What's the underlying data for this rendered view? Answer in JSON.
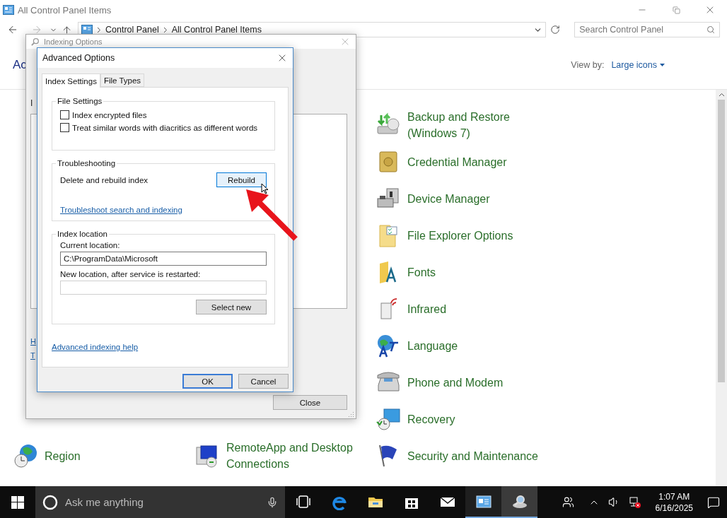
{
  "window": {
    "title": "All Control Panel Items"
  },
  "address_bar": {
    "breadcrumbs": [
      "Control Panel",
      "All Control Panel Items"
    ]
  },
  "search": {
    "placeholder": "Search Control Panel"
  },
  "header": {
    "title": "Ac",
    "view_by_label": "View by:",
    "view_by_value": "Large icons"
  },
  "columns": [
    {
      "items": [
        {
          "label": "Region",
          "kind": "region"
        }
      ]
    },
    {
      "items": [
        {
          "label": "RemoteApp and Desktop Connections",
          "kind": "remoteapp"
        }
      ]
    },
    {
      "items": [
        {
          "label": "Backup and Restore (Windows 7)",
          "kind": "backup"
        },
        {
          "label": "Credential Manager",
          "kind": "credential"
        },
        {
          "label": "Device Manager",
          "kind": "device"
        },
        {
          "label": "File Explorer Options",
          "kind": "folder-options"
        },
        {
          "label": "Fonts",
          "kind": "fonts"
        },
        {
          "label": "Infrared",
          "kind": "infrared"
        },
        {
          "label": "Language",
          "kind": "language"
        },
        {
          "label": "Phone and Modem",
          "kind": "phone"
        },
        {
          "label": "Recovery",
          "kind": "recovery"
        },
        {
          "label": "Security and Maintenance",
          "kind": "security"
        }
      ]
    }
  ],
  "indexing_dialog": {
    "title": "Indexing Options",
    "label_fragment": "I",
    "link_fragments": [
      "H",
      "T"
    ],
    "close_button": "Close"
  },
  "advanced_dialog": {
    "title": "Advanced Options",
    "tabs": [
      {
        "label": "Index Settings",
        "selected": true
      },
      {
        "label": "File Types",
        "selected": false
      }
    ],
    "file_settings": {
      "legend": "File Settings",
      "options": [
        {
          "label": "Index encrypted files",
          "checked": false
        },
        {
          "label": "Treat similar words with diacritics as different words",
          "checked": false
        }
      ]
    },
    "troubleshooting": {
      "legend": "Troubleshooting",
      "text": "Delete and rebuild index",
      "button": {
        "label": "Rebuild",
        "hovered": true
      },
      "link": "Troubleshoot search and indexing"
    },
    "index_location": {
      "legend": "Index location",
      "current_label": "Current location:",
      "current_value": "C:\\ProgramData\\Microsoft",
      "new_label": "New location, after service is restarted:",
      "button": "Select new"
    },
    "help_link": "Advanced indexing help",
    "buttons": [
      {
        "label": "OK",
        "default": true
      },
      {
        "label": "Cancel",
        "default": false
      }
    ]
  },
  "taskbar": {
    "search_placeholder": "Ask me anything",
    "apps": [
      {
        "kind": "task-view",
        "open": false,
        "focused": false
      },
      {
        "kind": "edge",
        "open": false,
        "focused": false
      },
      {
        "kind": "explorer",
        "open": false,
        "focused": false
      },
      {
        "kind": "store",
        "open": false,
        "focused": false
      },
      {
        "kind": "mail",
        "open": false,
        "focused": false
      },
      {
        "kind": "control-panel",
        "open": true,
        "focused": false
      },
      {
        "kind": "indexing",
        "open": true,
        "focused": true
      }
    ],
    "time": "1:07 AM",
    "date": "6/16/2025"
  }
}
